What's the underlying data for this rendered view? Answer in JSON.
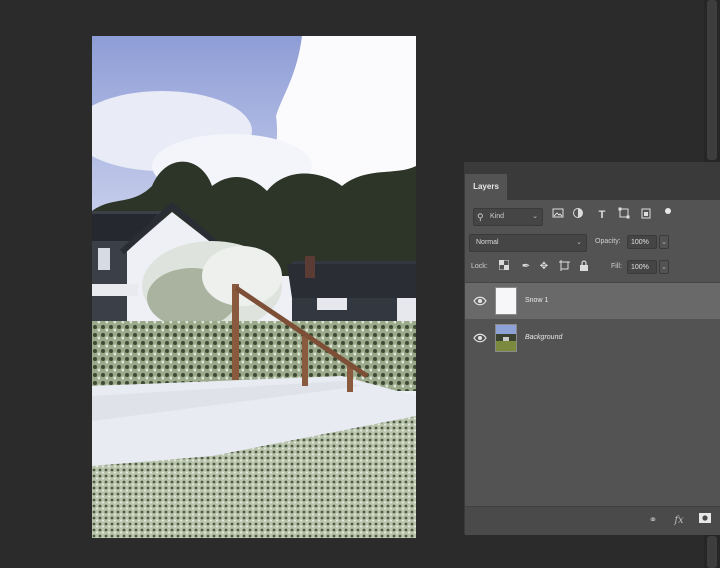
{
  "panel": {
    "tab_label": "Layers",
    "filter": {
      "kind_label": "Kind"
    },
    "blend_mode": "Normal",
    "opacity_label": "Opacity:",
    "opacity_value": "100%",
    "lock_label": "Lock:",
    "fill_label": "Fill:",
    "fill_value": "100%",
    "layers": [
      {
        "name": "Snow 1",
        "selected": true,
        "visible": true
      },
      {
        "name": "Background",
        "selected": false,
        "visible": true
      }
    ]
  },
  "colors": {
    "workspace": "#2b2b2b",
    "panel": "#535353",
    "selected_layer": "#696969",
    "sky": "#8e9dd6"
  },
  "icons": [
    "search-icon",
    "image-filter-icon",
    "adjustment-filter-icon",
    "type-filter-icon",
    "shape-filter-icon",
    "smart-object-filter-icon",
    "lock-transparent-icon",
    "lock-pixels-icon",
    "lock-position-icon",
    "lock-artboard-icon",
    "lock-all-icon",
    "eye-icon",
    "link-icon",
    "fx-icon",
    "mask-icon"
  ]
}
